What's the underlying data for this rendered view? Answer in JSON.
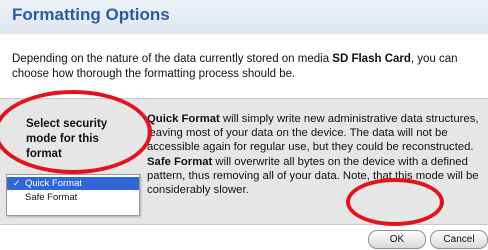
{
  "dialog": {
    "title": "Formatting Options",
    "intro": {
      "part1": "Depending on the nature of the data currently stored on media ",
      "media_name": "SD Flash Card",
      "part2": ", you can choose how thorough the formatting process should be."
    }
  },
  "options_panel": {
    "label": "Select security mode for this format",
    "description": {
      "quick_title": "Quick Format",
      "quick_text": " will simply write new administrative data structures, leaving most of your data on the device. The data will not be accessible again for regular use, but they could be reconstructed. ",
      "safe_title": "Safe Format",
      "safe_text": " will overwrite all bytes on the device with a defined pattern, thus removing all of your data. Note, that this mode will be considerably slower."
    },
    "dropdown": {
      "selected": "Quick Format",
      "options": [
        "Quick Format",
        "Safe Format"
      ],
      "check_glyph": "✓"
    }
  },
  "buttons": {
    "ok": "OK",
    "cancel": "Cancel"
  },
  "colors": {
    "title": "#2b5aa8",
    "highlight": "#2f67d6",
    "annotation": "#e4121c"
  }
}
